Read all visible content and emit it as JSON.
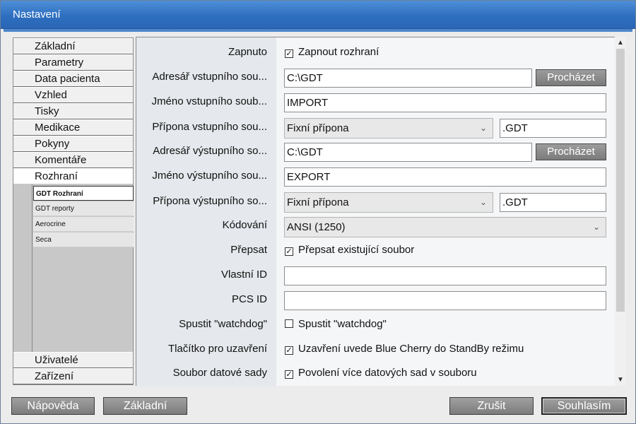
{
  "window": {
    "title": "Nastavení"
  },
  "nav": {
    "items": [
      "Základní",
      "Parametry",
      "Data pacienta",
      "Vzhled",
      "Tisky",
      "Medikace",
      "Pokyny",
      "Komentáře",
      "Rozhraní"
    ],
    "sub_items": [
      "GDT Rozhraní",
      "GDT reporty",
      "Aerocrine",
      "Seca"
    ],
    "bottom_items": [
      "Uživatelé",
      "Zařízení"
    ]
  },
  "form": {
    "enabled": {
      "label": "Zapnuto",
      "checkbox": "Zapnout rozhraní",
      "checked": true
    },
    "input_dir": {
      "label": "Adresář vstupního sou...",
      "value": "C:\\GDT",
      "button": "Procházet"
    },
    "input_name": {
      "label": "Jméno vstupního soub...",
      "value": "IMPORT"
    },
    "input_ext": {
      "label": "Přípona vstupního sou...",
      "select": "Fixní přípona",
      "value": ".GDT"
    },
    "output_dir": {
      "label": "Adresář výstupního so...",
      "value": "C:\\GDT",
      "button": "Procházet"
    },
    "output_name": {
      "label": "Jméno výstupního sou...",
      "value": "EXPORT"
    },
    "output_ext": {
      "label": "Přípona výstupního so...",
      "select": "Fixní přípona",
      "value": ".GDT"
    },
    "encoding": {
      "label": "Kódování",
      "select": "ANSI (1250)"
    },
    "overwrite": {
      "label": "Přepsat",
      "checkbox": "Přepsat existující soubor",
      "checked": true
    },
    "own_id": {
      "label": "Vlastní ID",
      "value": ""
    },
    "pcs_id": {
      "label": "PCS ID",
      "value": ""
    },
    "watchdog": {
      "label": "Spustit \"watchdog\"",
      "checkbox": "Spustit \"watchdog\"",
      "checked": false
    },
    "close_button": {
      "label": "Tlačítko pro uzavření",
      "checkbox": "Uzavření uvede Blue Cherry do StandBy režimu",
      "checked": true
    },
    "data_file": {
      "label": "Soubor datové sady",
      "checkbox": "Povolení více datových sad v souboru",
      "checked": true
    }
  },
  "footer": {
    "help": "Nápověda",
    "defaults": "Základní",
    "cancel": "Zrušit",
    "ok": "Souhlasím"
  },
  "icons": {
    "checkmark": "✓",
    "chevron": "⌄",
    "scroll_up": "▲",
    "scroll_down": "▼"
  },
  "colors": {
    "titlebar": "#2e6fc0",
    "button": "#8a8a8a"
  }
}
